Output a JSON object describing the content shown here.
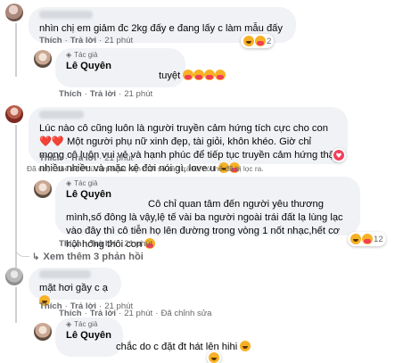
{
  "comments": [
    {
      "text": "nhìn chị em giảm đc 2kg đấy e đang lấy c làm mẫu đấy",
      "actions": {
        "like": "Thích",
        "reply": "Trả lời",
        "time": "21 phút"
      },
      "reaction_count": "2",
      "reply": {
        "badge": "Tác giả",
        "name": "Lê Quyên",
        "text": "tuyệt",
        "actions": {
          "like": "Thích",
          "reply": "Trả lời",
          "time": "21 phút"
        }
      }
    },
    {
      "text": "Lúc nào cô cũng luôn là người truyền cảm hứng tích cực cho con ❤️❤️ Một người phụ nữ xinh đẹp, tài giỏi, khôn khéo. Giờ chỉ mong cô luôn vui vẻ và hạnh phúc để tiếp tục truyền cảm hứng thật nhiều nhiều và mặc kệ đời nói gì, love u",
      "actions": {
        "like": "Thích",
        "reply": "Trả lời",
        "time": "21 phút"
      },
      "filter_note": "Đã chọn chế độ Phù hợp nhất nên một số câu trả lời có thể đã bị lọc ra.",
      "reply": {
        "badge": "Tác giả",
        "name": "Lê Quyên",
        "text": "Cô chỉ quan tâm đến người yêu thương mình,số đông là vậy,lệ tế vài ba người ngoài trái đất lạ lùng lạc vào đây thì cô tiễn họ lên đường trong vòng 1 nốt nhạc,hết cơ hội hóng thôi con",
        "actions": {
          "like": "Thích",
          "reply": "Trả lời",
          "time": "21 phút"
        },
        "reaction_count": "12"
      },
      "more_replies": "Xem thêm 3 phản hồi"
    },
    {
      "text": "mặt hơi gầy c ạ",
      "actions": {
        "like": "Thích",
        "reply": "Trả lời",
        "time": "21 phút"
      },
      "reply": {
        "badge": "Tác giả",
        "name": "Lê Quyên",
        "text": "chắc do c đặt đt hát lên hihi",
        "actions": {
          "like": "Thích",
          "reply": "Trả lời",
          "time": "21 phút",
          "edited": "Đã chỉnh sửa"
        }
      }
    }
  ],
  "colors": {
    "bubble": "#f0f2f5",
    "meta": "#65676b",
    "text": "#050505",
    "thread": "#ced0d4"
  },
  "icons": [
    "haha-emoji",
    "heart-emoji",
    "care-emoji",
    "author-badge-icon",
    "reply-arrow-icon"
  ]
}
